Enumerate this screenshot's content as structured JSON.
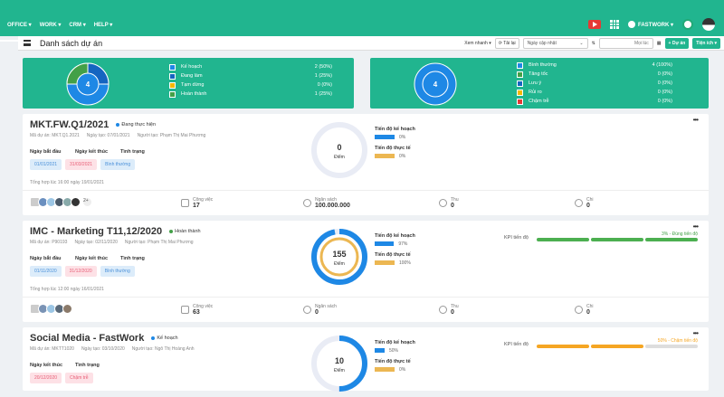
{
  "nav": {
    "office": "OFFICE ▾",
    "work": "WORK ▾",
    "crm": "CRM ▾",
    "help": "HELP ▾",
    "company": "FASTWORK ▾"
  },
  "subbar": {
    "title": "Danh sách dự án",
    "quick_view": "Xem nhanh ▾",
    "reload": "Tải lại",
    "sort_select": "Ngày cập nhật",
    "search_placeholder": "Mọi lúc",
    "add_project": "+ Dự án",
    "utilities": "Tiện ích ▾"
  },
  "summary_left": {
    "total": "4",
    "items": [
      {
        "label": "Kế hoạch",
        "value": "2 (50%)",
        "color": "#1e88e5"
      },
      {
        "label": "Đang làm",
        "value": "1 (25%)",
        "color": "#1565c0"
      },
      {
        "label": "Tạm dừng",
        "value": "0 (0%)",
        "color": "#f5b800"
      },
      {
        "label": "Hoàn thành",
        "value": "1 (25%)",
        "color": "#43a047"
      }
    ]
  },
  "summary_right": {
    "total": "4",
    "items": [
      {
        "label": "Bình thường",
        "value": "4 (100%)",
        "color": "#1e88e5"
      },
      {
        "label": "Tăng tốc",
        "value": "0 (0%)",
        "color": "#43a047"
      },
      {
        "label": "Lưu ý",
        "value": "0 (0%)",
        "color": "#1565c0"
      },
      {
        "label": "Rủi ro",
        "value": "0 (0%)",
        "color": "#f5b800"
      },
      {
        "label": "Chậm trễ",
        "value": "0 (0%)",
        "color": "#e53935"
      }
    ]
  },
  "projects": [
    {
      "title": "MKT.FW.Q1/2021",
      "status": "Đang thực hiện",
      "status_color": "#1e88e5",
      "code": "Mã dự án: MKT.Q1.2021",
      "created": "Ngày tạo: 07/01/2021",
      "creator": "Người tạo: Phạm Thị Mai Phương",
      "start_label": "Ngày bắt đầu",
      "end_label": "Ngày kết thúc",
      "state_label": "Tình trạng",
      "start": "01/01/2021",
      "end": "31/03/2021",
      "state": "Bình thường",
      "summary": "Tổng hợp lúc 16:00 ngày 19/01/2021",
      "members_more": "2+",
      "tasks_label": "Công việc",
      "tasks": "17",
      "budget_label": "Ngân sách",
      "budget": "100.000.000",
      "income_label": "Thu",
      "income": "0",
      "expense_label": "Chi",
      "expense": "0",
      "score": "0",
      "score_label": "Điểm",
      "plan_label": "Tiến độ kế hoạch",
      "plan": "0%",
      "actual_label": "Tiến độ thực tế",
      "actual": "0%",
      "score_progress": 0,
      "plan_progress": 0,
      "actual_progress": 0
    },
    {
      "title": "IMC - Marketing T11,12/2020",
      "status": "Hoàn thành",
      "status_color": "#43a047",
      "code": "Mã dự án: P90193",
      "created": "Ngày tạo: 02/11/2020",
      "creator": "Người tạo: Phạm Thị Mai Phương",
      "start_label": "Ngày bắt đầu",
      "end_label": "Ngày kết thúc",
      "state_label": "Tình trạng",
      "start": "01/11/2020",
      "end": "31/12/2020",
      "state": "Bình thường",
      "summary": "Tổng hợp lúc 12:00 ngày 16/01/2021",
      "tasks_label": "Công việc",
      "tasks": "63",
      "budget_label": "Ngân sách",
      "budget": "0",
      "income_label": "Thu",
      "income": "0",
      "expense_label": "Chi",
      "expense": "0",
      "score": "155",
      "score_label": "Điểm",
      "plan_label": "Tiến độ kế hoạch",
      "plan": "97%",
      "actual_label": "Tiến độ thực tế",
      "actual": "100%",
      "kpi_label": "KPI tiến độ",
      "kpi_tag": "3% - Đúng tiến độ",
      "score_progress": 0.97,
      "plan_progress": 0.97,
      "actual_progress": 1
    },
    {
      "title": "Social Media - FastWork",
      "status": "Kế hoạch",
      "status_color": "#1e88e5",
      "code": "Mã dự án: MKTT1020",
      "created": "Ngày tạo: 03/10/2020",
      "creator": "Người tạo: Ngô Thị Hoàng Anh",
      "end_label": "Ngày kết thúc",
      "state_label": "Tình trạng",
      "end": "20/12/2020",
      "state": "Chậm trễ",
      "score": "10",
      "score_label": "Điểm",
      "plan_label": "Tiến độ kế hoạch",
      "plan": "50%",
      "actual_label": "Tiến độ thực tế",
      "actual": "0%",
      "kpi_label": "KPI tiến độ",
      "kpi_tag": "50% - Chậm tiến độ",
      "score_progress": 0.5,
      "plan_progress": 0.5,
      "actual_progress": 0
    }
  ]
}
